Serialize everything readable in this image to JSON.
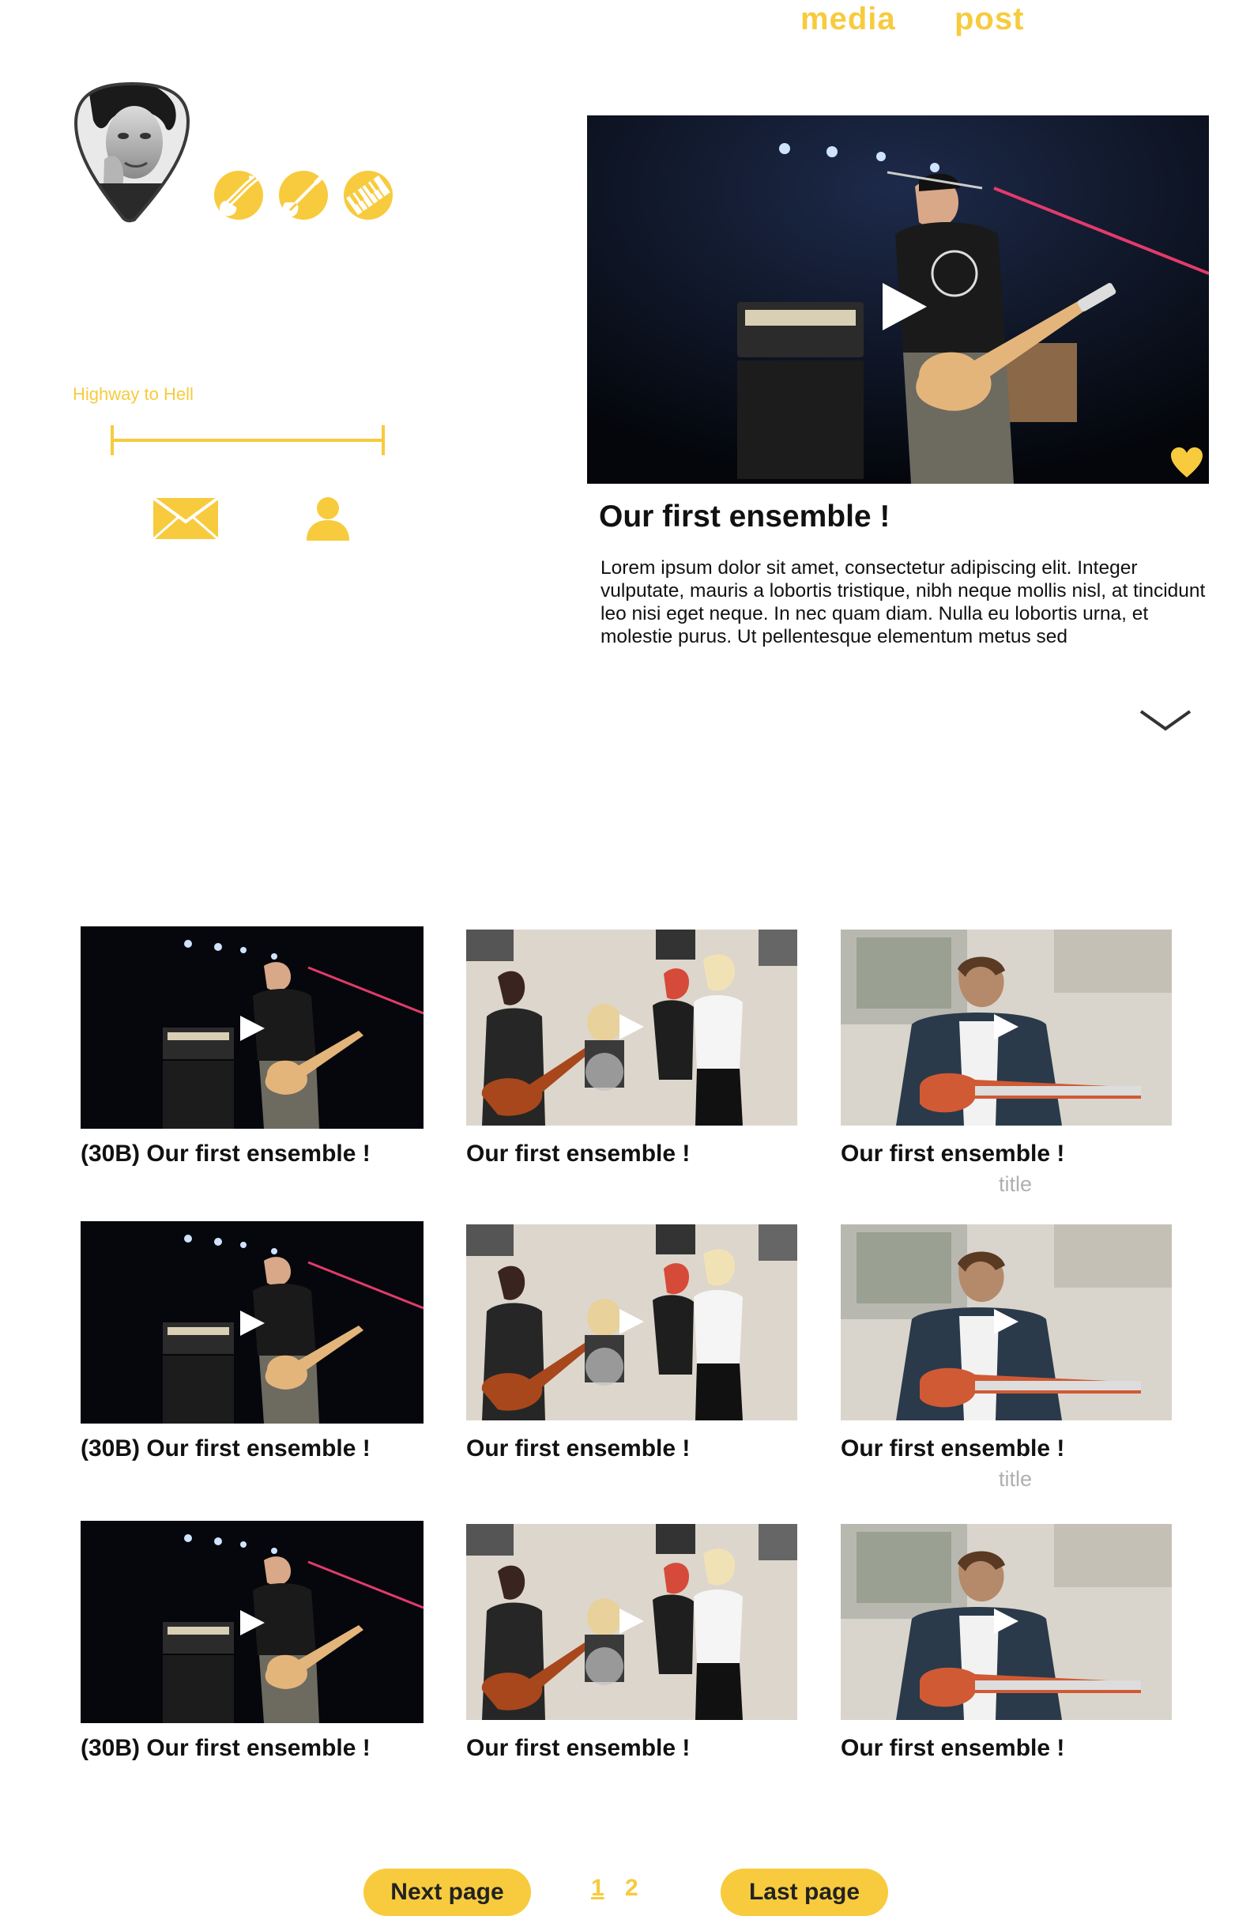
{
  "nav": {
    "tabs": [
      {
        "label": "media"
      },
      {
        "label": "post"
      }
    ]
  },
  "profile": {
    "skills": [
      "bass-guitar-icon",
      "electric-guitar-icon",
      "piano-keys-icon"
    ],
    "now_playing": {
      "title": "Highway to Hell"
    },
    "actions": [
      "mail-icon",
      "user-icon"
    ]
  },
  "featured": {
    "title": "Our first ensemble !",
    "description": "Lorem ipsum dolor sit amet, consectetur adipiscing elit. Integer vulputate, mauris a lobortis tristique, nibh neque mollis nisl, at tincidunt leo nisi eget neque. In nec quam diam. Nulla eu lobortis urna, et molestie purus. Ut pellentesque elementum metus sed"
  },
  "grid": {
    "rows": [
      [
        {
          "title": "(30B) Our first ensemble !"
        },
        {
          "title": "Our first ensemble !"
        },
        {
          "title": "Our first ensemble !",
          "subtitle": "title"
        }
      ],
      [
        {
          "title": "(30B) Our first ensemble !"
        },
        {
          "title": "Our first ensemble !"
        },
        {
          "title": "Our first ensemble !",
          "subtitle": "title"
        }
      ],
      [
        {
          "title": "(30B) Our first ensemble !"
        },
        {
          "title": "Our first ensemble !"
        },
        {
          "title": "Our first ensemble !"
        }
      ]
    ]
  },
  "pagination": {
    "next_label": "Next page",
    "pages": [
      "1",
      "2"
    ],
    "current": "1",
    "last_label": "Last page"
  },
  "colors": {
    "accent": "#f7cb3d",
    "text": "#111111",
    "muted": "#b0b0b0"
  }
}
